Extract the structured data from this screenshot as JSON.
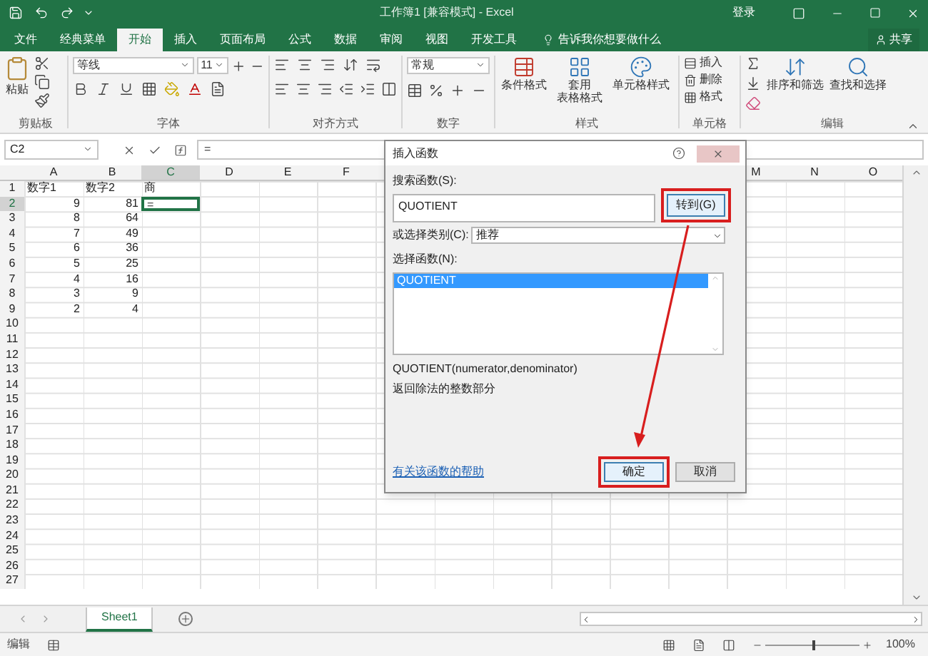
{
  "window": {
    "title": "工作簿1 [兼容模式] - Excel",
    "sign_in": "登录"
  },
  "tabs": [
    {
      "label": "文件",
      "selected": false
    },
    {
      "label": "经典菜单",
      "selected": false
    },
    {
      "label": "开始",
      "selected": true
    },
    {
      "label": "插入",
      "selected": false
    },
    {
      "label": "页面布局",
      "selected": false
    },
    {
      "label": "公式",
      "selected": false
    },
    {
      "label": "数据",
      "selected": false
    },
    {
      "label": "审阅",
      "selected": false
    },
    {
      "label": "视图",
      "selected": false
    },
    {
      "label": "开发工具",
      "selected": false
    }
  ],
  "tell_me": "告诉我你想要做什么",
  "share": "共享",
  "ribbon": {
    "clipboard": {
      "paste": "粘贴",
      "label": "剪贴板"
    },
    "font": {
      "name": "等线",
      "size": "11",
      "label": "字体"
    },
    "alignment": {
      "label": "对齐方式"
    },
    "number": {
      "format": "常规",
      "label": "数字"
    },
    "styles": {
      "label": "样式",
      "conditional": "条件格式",
      "table": [
        "套用",
        "表格格式"
      ],
      "cell": "单元格样式"
    },
    "cells": {
      "label": "单元格",
      "insert": "插入",
      "delete": "删除",
      "format": "格式"
    },
    "editing": {
      "label": "编辑",
      "sort": "排序和筛选",
      "find": "查找和选择"
    }
  },
  "formula_bar": {
    "name_box": "C2",
    "formula": "="
  },
  "sheet": {
    "column_headers": {
      "left": [
        "A",
        "B",
        "C",
        "D",
        "E",
        "F"
      ],
      "right": [
        "M",
        "N",
        "O"
      ]
    },
    "rows": [
      {
        "number": "1",
        "cells": [
          {
            "text": "数字1",
            "kind": "text",
            "selected": false
          },
          {
            "text": "数字2",
            "kind": "text",
            "selected": false
          },
          {
            "text": "商",
            "kind": "text",
            "selected": false
          }
        ]
      },
      {
        "number": "2",
        "cells": [
          {
            "text": "9",
            "kind": "number",
            "selected": false
          },
          {
            "text": "81",
            "kind": "number",
            "selected": false
          },
          {
            "text": "=",
            "kind": "text",
            "selected": true
          }
        ]
      },
      {
        "number": "3",
        "cells": [
          {
            "text": "8",
            "kind": "number",
            "selected": false
          },
          {
            "text": "64",
            "kind": "number",
            "selected": false
          }
        ]
      },
      {
        "number": "4",
        "cells": [
          {
            "text": "7",
            "kind": "number",
            "selected": false
          },
          {
            "text": "49",
            "kind": "number",
            "selected": false
          }
        ]
      },
      {
        "number": "5",
        "cells": [
          {
            "text": "6",
            "kind": "number",
            "selected": false
          },
          {
            "text": "36",
            "kind": "number",
            "selected": false
          }
        ]
      },
      {
        "number": "6",
        "cells": [
          {
            "text": "5",
            "kind": "number",
            "selected": false
          },
          {
            "text": "25",
            "kind": "number",
            "selected": false
          }
        ]
      },
      {
        "number": "7",
        "cells": [
          {
            "text": "4",
            "kind": "number",
            "selected": false
          },
          {
            "text": "16",
            "kind": "number",
            "selected": false
          }
        ]
      },
      {
        "number": "8",
        "cells": [
          {
            "text": "3",
            "kind": "number",
            "selected": false
          },
          {
            "text": "9",
            "kind": "number",
            "selected": false
          }
        ]
      },
      {
        "number": "9",
        "cells": [
          {
            "text": "2",
            "kind": "number",
            "selected": false
          },
          {
            "text": "4",
            "kind": "number",
            "selected": false
          }
        ]
      },
      {
        "number": "10"
      },
      {
        "number": "11"
      },
      {
        "number": "12"
      },
      {
        "number": "13"
      },
      {
        "number": "14"
      },
      {
        "number": "15"
      },
      {
        "number": "16"
      },
      {
        "number": "17"
      },
      {
        "number": "18"
      },
      {
        "number": "19"
      },
      {
        "number": "20"
      },
      {
        "number": "21"
      },
      {
        "number": "22"
      },
      {
        "number": "23"
      },
      {
        "number": "24"
      },
      {
        "number": "25"
      },
      {
        "number": "26"
      },
      {
        "number": "27"
      }
    ]
  },
  "dialog": {
    "title": "插入函数",
    "search_label": "搜索函数(S):",
    "search_value": "QUOTIENT",
    "go_button": "转到(G)",
    "category_label": "或选择类别(C):",
    "category_value": "推荐",
    "list_label": "选择函数(N):",
    "functions": [
      {
        "name": "QUOTIENT",
        "selected": true
      }
    ],
    "signature": "QUOTIENT(numerator,denominator)",
    "description": "返回除法的整数部分",
    "help_link": "有关该函数的帮助",
    "ok": "确定",
    "cancel": "取消"
  },
  "sheet_tabs": [
    {
      "label": "Sheet1",
      "selected": true
    }
  ],
  "status_bar": {
    "mode": "编辑",
    "zoom": "100%",
    "zoom_slider": {
      "level": 0.5
    }
  }
}
